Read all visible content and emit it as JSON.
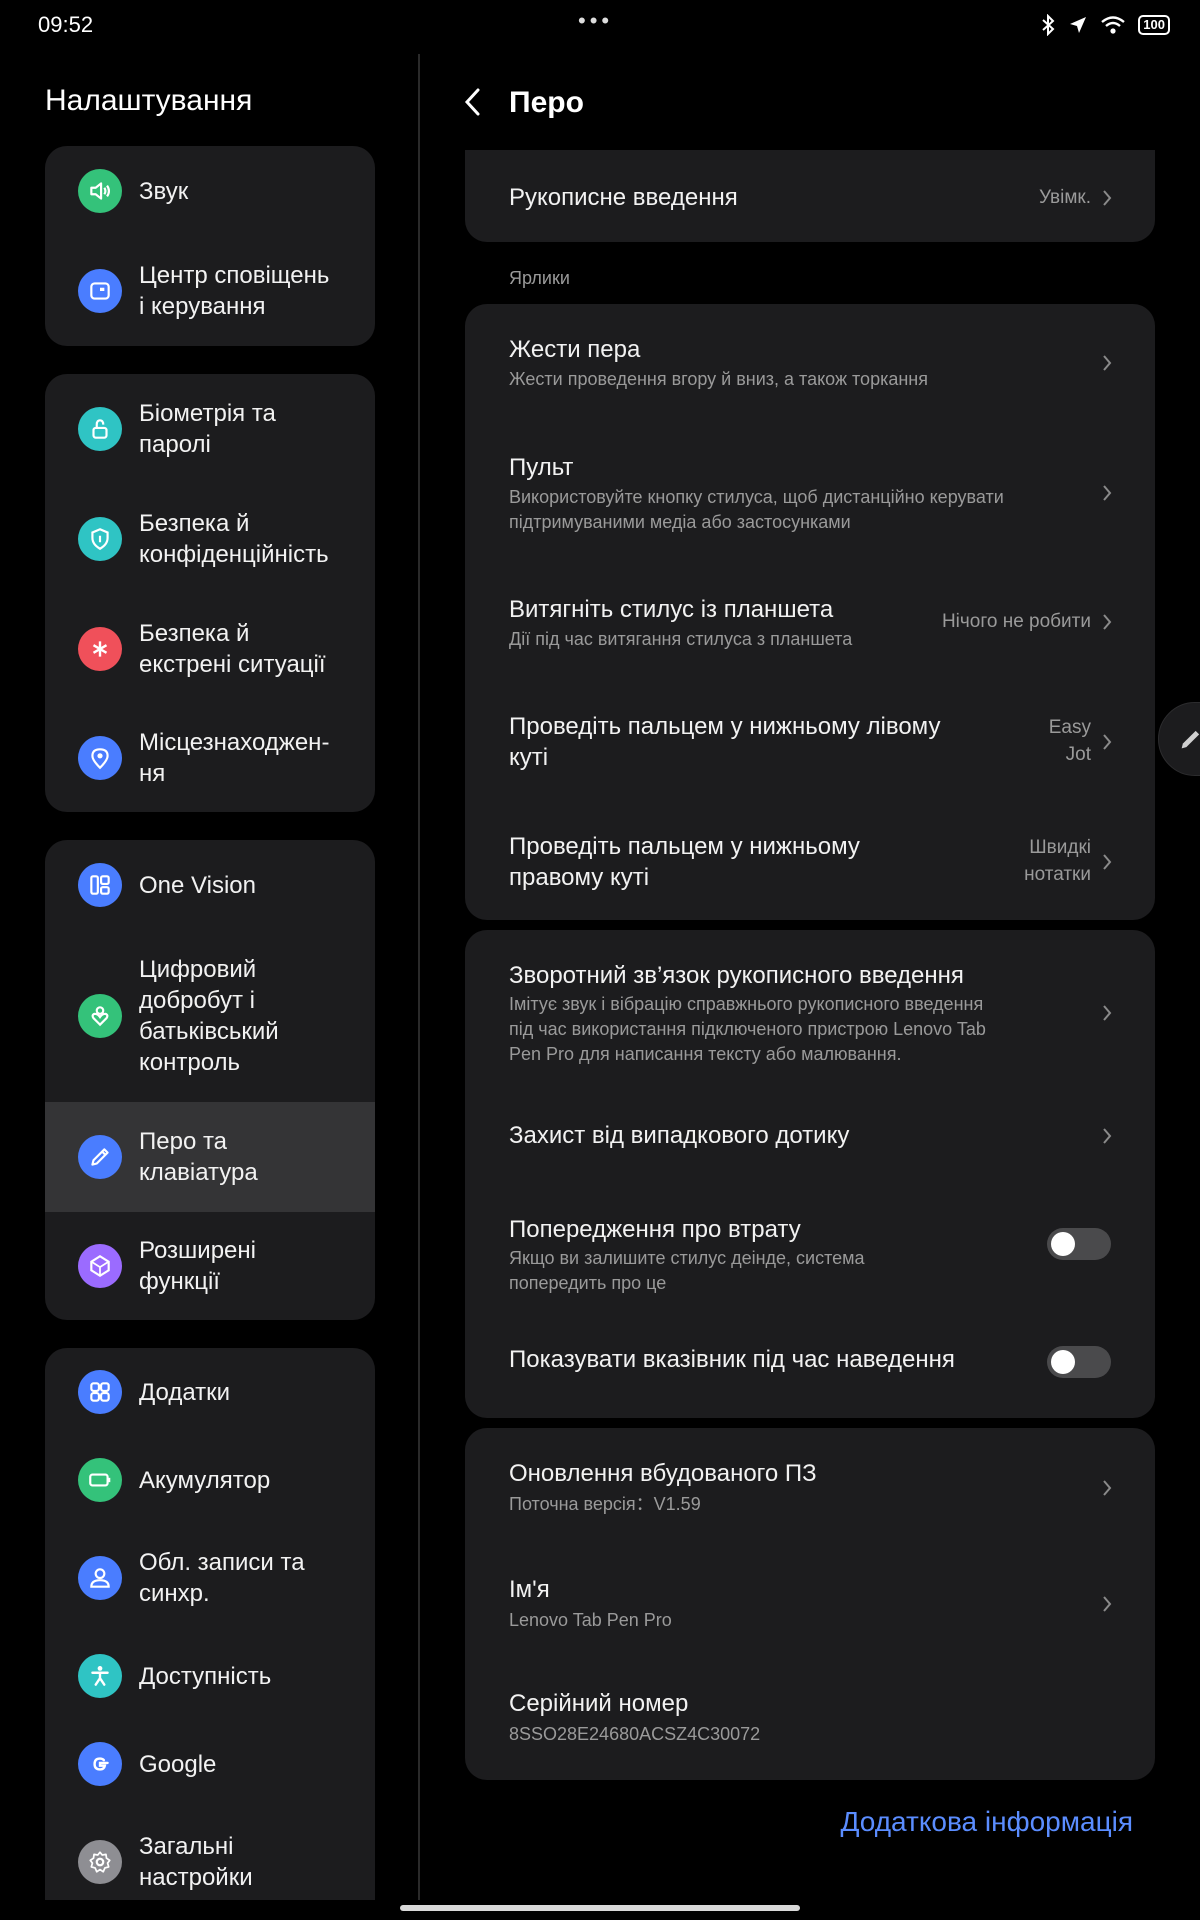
{
  "status_bar": {
    "time": "09:52",
    "battery": "100"
  },
  "left": {
    "title": "Налаштування",
    "items": [
      {
        "label": "Звук",
        "icon": "speaker-icon",
        "color": "#34c27a"
      },
      {
        "label": "Центр сповіщень\nі керування",
        "icon": "notification-center-icon",
        "color": "#4a7dff"
      },
      {
        "label": "Біометрія та\nпаролі",
        "icon": "lock-icon",
        "color": "#2fc4c4"
      },
      {
        "label": "Безпека й\nконфіденційність",
        "icon": "shield-icon",
        "color": "#2fc4c4"
      },
      {
        "label": "Безпека й\nекстрені ситуації",
        "icon": "emergency-icon",
        "color": "#f0505a"
      },
      {
        "label": "Місцезнаходжен-\nня",
        "icon": "location-pin-icon",
        "color": "#4a7dff"
      },
      {
        "label": "One Vision",
        "icon": "one-vision-icon",
        "color": "#4a7dff"
      },
      {
        "label": "Цифровий\nдобробут і\nбатьківський\nконтроль",
        "icon": "wellbeing-icon",
        "color": "#34c27a"
      },
      {
        "label": "Перо та\nклавіатура",
        "icon": "pen-icon",
        "color": "#4a7dff"
      },
      {
        "label": "Розширені\nфункції",
        "icon": "advanced-features-icon",
        "color": "#9b6bff"
      },
      {
        "label": "Додатки",
        "icon": "apps-grid-icon",
        "color": "#4a7dff"
      },
      {
        "label": "Акумулятор",
        "icon": "battery-icon",
        "color": "#34c27a"
      },
      {
        "label": "Обл. записи та\nсинхр.",
        "icon": "account-icon",
        "color": "#4a7dff"
      },
      {
        "label": "Доступність",
        "icon": "accessibility-icon",
        "color": "#2fc4c4"
      },
      {
        "label": "Google",
        "icon": "google-icon",
        "color": "#4a7dff"
      },
      {
        "label": "Загальні\nнастройки",
        "icon": "gear-icon",
        "color": "#8e8e93"
      }
    ]
  },
  "right": {
    "title": "Перо",
    "handwriting": {
      "title": "Рукописне введення",
      "value": "Увімк."
    },
    "shortcuts_label": "Ярлики",
    "shortcuts": [
      {
        "title": "Жести пера",
        "subtitle": "Жести проведення вгору й вниз, а також торкання"
      },
      {
        "title": "Пульт",
        "subtitle": "Використовуйте кнопку стилуса, щоб дистанційно керувати\nпідтримуваними медіа або застосунками"
      },
      {
        "title": "Витягніть стилус із планшета",
        "subtitle": "Дії під час витягання стилуса з планшета",
        "value": "Нічого не робити"
      },
      {
        "title": "Проведіть пальцем у нижньому лівому\nкуті",
        "value": "Easy\nJot"
      },
      {
        "title": "Проведіть пальцем у нижньому\nправому куті",
        "value": "Швидкі\nнотатки"
      }
    ],
    "feedback": {
      "title": "Зворотний зв’язок рукописного введення",
      "subtitle": "Імітує звук і вібрацію справжнього рукописного введення\nпід час використання підключеного пристрою Lenovo Tab\nPen Pro для написання тексту або малювання."
    },
    "palm": {
      "title": "Захист від випадкового дотику"
    },
    "loss_warning": {
      "title": "Попередження про втрату",
      "subtitle": "Якщо ви залишите стилус деінде, система\nпопередить про це",
      "enabled": false
    },
    "hover_pointer": {
      "title": "Показувати вказівник під час наведення",
      "enabled": false
    },
    "firmware": {
      "title": "Оновлення вбудованого ПЗ",
      "subtitle": "Поточна версія：V1.59"
    },
    "name": {
      "title": "Ім'я",
      "subtitle": "Lenovo Tab Pen Pro"
    },
    "serial": {
      "title": "Серійний номер",
      "subtitle": "8SSO28E24680ACSZ4C30072"
    },
    "more_link": "Додаткова інформація"
  }
}
